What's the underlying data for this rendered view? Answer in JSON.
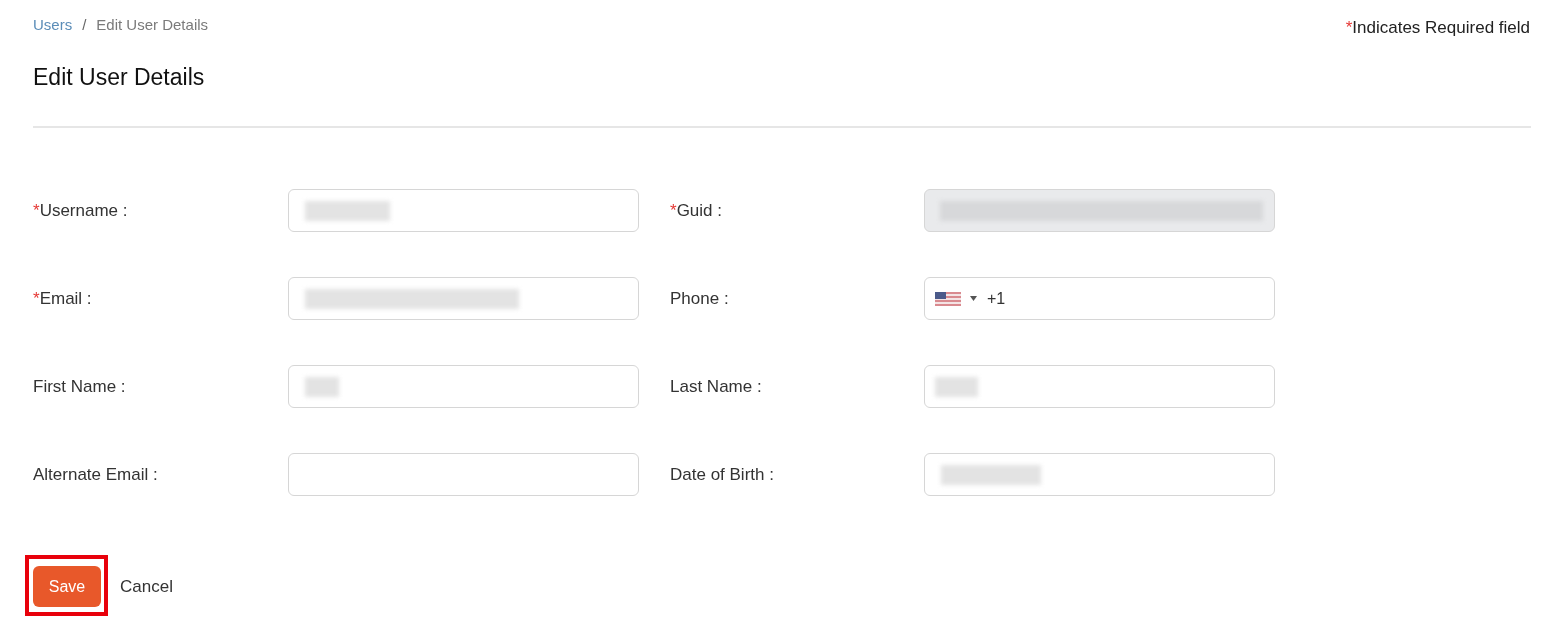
{
  "breadcrumb": {
    "separator": "/",
    "items": [
      {
        "label": "Users",
        "kind": "link"
      },
      {
        "label": "Edit User Details",
        "kind": "current"
      }
    ]
  },
  "required_note": {
    "marker": "*",
    "text": "Indicates Required field"
  },
  "title": "Edit User Details",
  "fields": [
    {
      "label": "Username :",
      "required_marker": "*",
      "kind": "text",
      "disabled": false,
      "redacted": true
    },
    {
      "label": "Guid :",
      "required_marker": "*",
      "kind": "text",
      "disabled": true,
      "redacted": true
    },
    {
      "label": "Email :",
      "required_marker": "*",
      "kind": "text",
      "disabled": false,
      "redacted": true
    },
    {
      "label": "Phone :",
      "kind": "phone",
      "disabled": false,
      "redacted": false,
      "value": "+1"
    },
    {
      "label": "First Name :",
      "kind": "text",
      "disabled": false,
      "redacted": true
    },
    {
      "label": "Last Name :",
      "kind": "text",
      "disabled": false,
      "redacted": true
    },
    {
      "label": "Alternate Email :",
      "kind": "text",
      "disabled": false,
      "redacted": false
    },
    {
      "label": "Date of Birth :",
      "kind": "text",
      "disabled": false,
      "redacted": true
    }
  ],
  "actions": [
    {
      "label": "Save",
      "kind": "primary",
      "highlighted": true
    },
    {
      "label": "Cancel",
      "kind": "link",
      "highlighted": false
    }
  ]
}
